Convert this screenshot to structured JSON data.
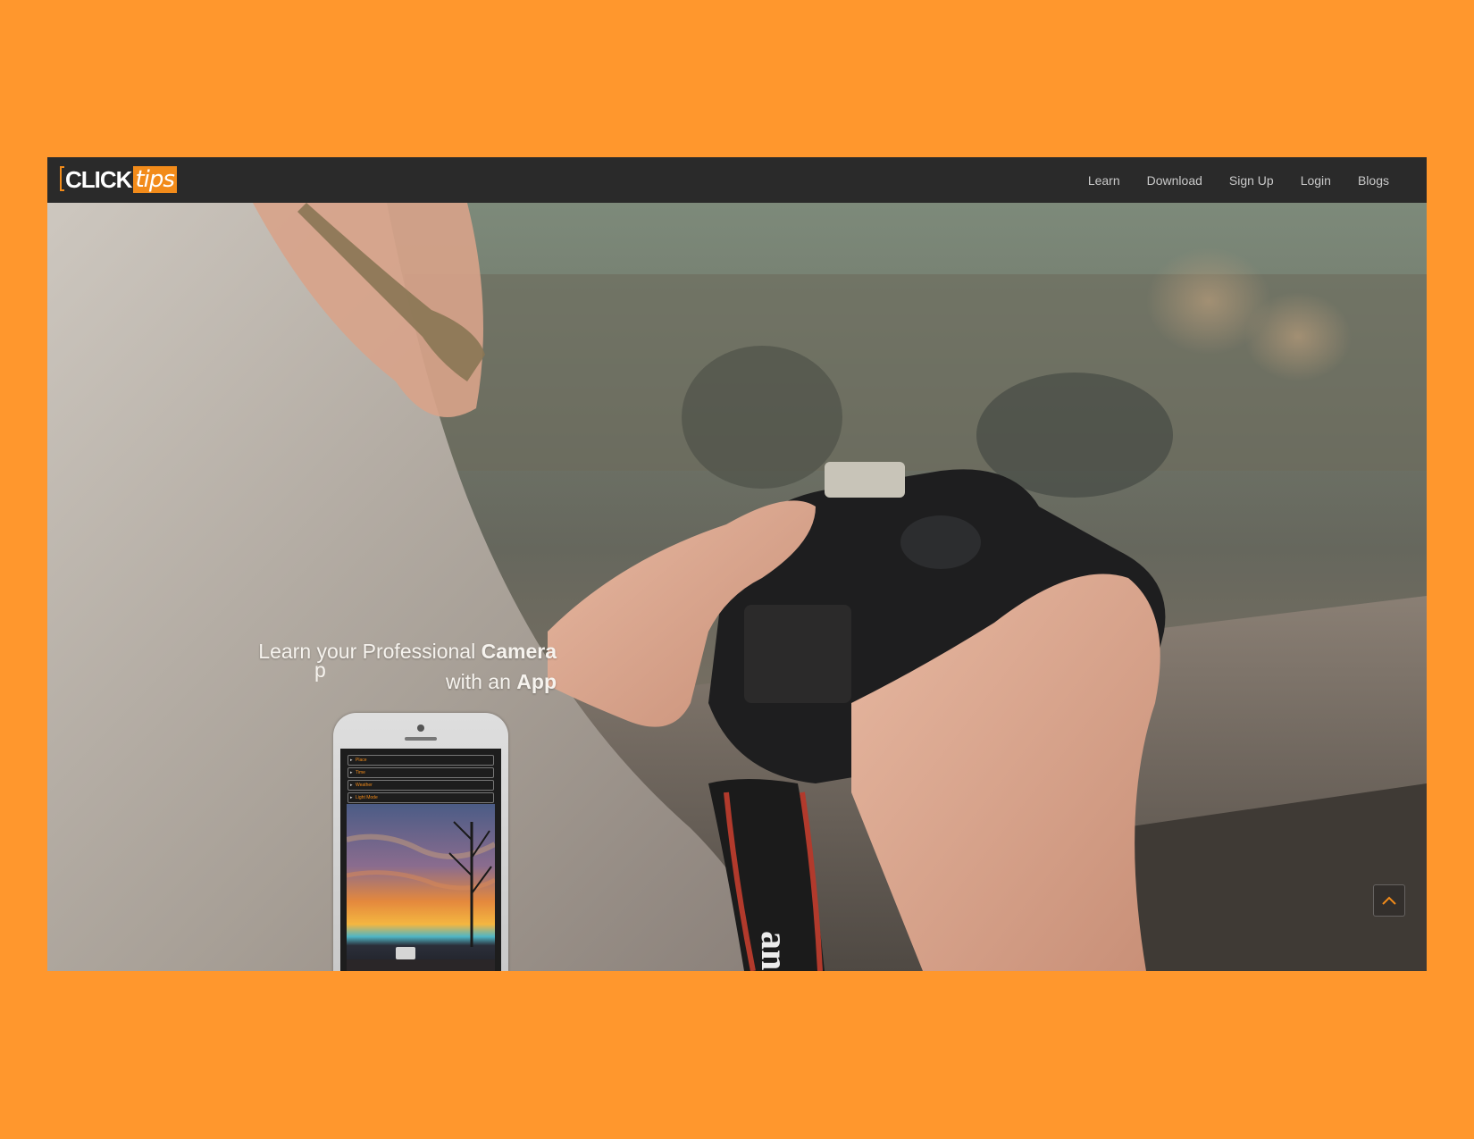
{
  "brand": {
    "logo_main": "CLICK",
    "logo_accent": "tips",
    "accent_color": "#f28b1a",
    "frame_color": "#ff972d"
  },
  "nav": {
    "items": [
      {
        "label": "Learn"
      },
      {
        "label": "Download"
      },
      {
        "label": "Sign Up"
      },
      {
        "label": "Login"
      },
      {
        "label": "Blogs"
      }
    ]
  },
  "hero": {
    "line1_regular": "Learn your Professional ",
    "line1_bold": "Camera",
    "line2_regular": "with an ",
    "line2_bold": "App",
    "stray_char": "p",
    "strap_text": "anon"
  },
  "phone": {
    "menu": [
      {
        "label": "Place"
      },
      {
        "label": "Time"
      },
      {
        "label": "Weather"
      },
      {
        "label": "Light Mode"
      }
    ]
  },
  "icons": {
    "scroll_top": "chevron-up-icon"
  }
}
